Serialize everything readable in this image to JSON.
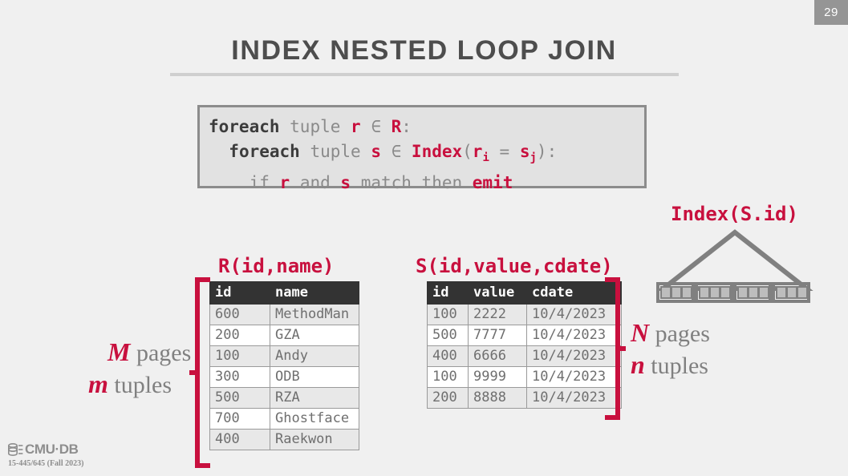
{
  "slide": {
    "page_number": "29",
    "title": "INDEX NESTED LOOP JOIN",
    "background_color": "#f0f0f0",
    "accent_color": "#c8103e",
    "muted_color": "#808080"
  },
  "code_block": {
    "line1": {
      "kw": "foreach",
      "t1": " tuple ",
      "v1": "r",
      "t2": " ∈ ",
      "v2": "R",
      "t3": ":"
    },
    "line2": {
      "indent": "  ",
      "kw": "foreach",
      "t1": " tuple ",
      "v1": "s",
      "t2": " ∈ ",
      "v2": "Index",
      "t3": "(",
      "v3": "r",
      "sub3": "i",
      "t4": " = ",
      "v4": "s",
      "sub4": "j",
      "t5": "):"
    },
    "line3": {
      "indent": "    ",
      "t1": "if ",
      "v1": "r",
      "t2": " and ",
      "v2": "s",
      "t3": " match then ",
      "v3": "emit"
    }
  },
  "r_table": {
    "caption": "R(id,name)",
    "columns": [
      "id",
      "name"
    ],
    "rows": [
      {
        "id": "600",
        "name": "MethodMan"
      },
      {
        "id": "200",
        "name": "GZA"
      },
      {
        "id": "100",
        "name": "Andy"
      },
      {
        "id": "300",
        "name": "ODB"
      },
      {
        "id": "500",
        "name": "RZA"
      },
      {
        "id": "700",
        "name": "Ghostface"
      },
      {
        "id": "400",
        "name": "Raekwon"
      }
    ],
    "annotation_pages_symbol": "M",
    "annotation_pages_label": " pages",
    "annotation_tuples_symbol": "m",
    "annotation_tuples_label": " tuples"
  },
  "s_table": {
    "caption": "S(id,value,cdate)",
    "columns": [
      "id",
      "value",
      "cdate"
    ],
    "rows": [
      {
        "id": "100",
        "value": "2222",
        "cdate": "10/4/2023"
      },
      {
        "id": "500",
        "value": "7777",
        "cdate": "10/4/2023"
      },
      {
        "id": "400",
        "value": "6666",
        "cdate": "10/4/2023"
      },
      {
        "id": "100",
        "value": "9999",
        "cdate": "10/4/2023"
      },
      {
        "id": "200",
        "value": "8888",
        "cdate": "10/4/2023"
      }
    ],
    "annotation_pages_symbol": "N",
    "annotation_pages_label": " pages",
    "annotation_tuples_symbol": "n",
    "annotation_tuples_label": " tuples"
  },
  "index_diagram": {
    "caption": "Index(S.id)",
    "leaf_groups": 4,
    "cells_per_group": 3,
    "shape_color": "#808080"
  },
  "footer": {
    "logo_text": "CMU·DB",
    "course": "15-445/645 (Fall 2023)"
  }
}
